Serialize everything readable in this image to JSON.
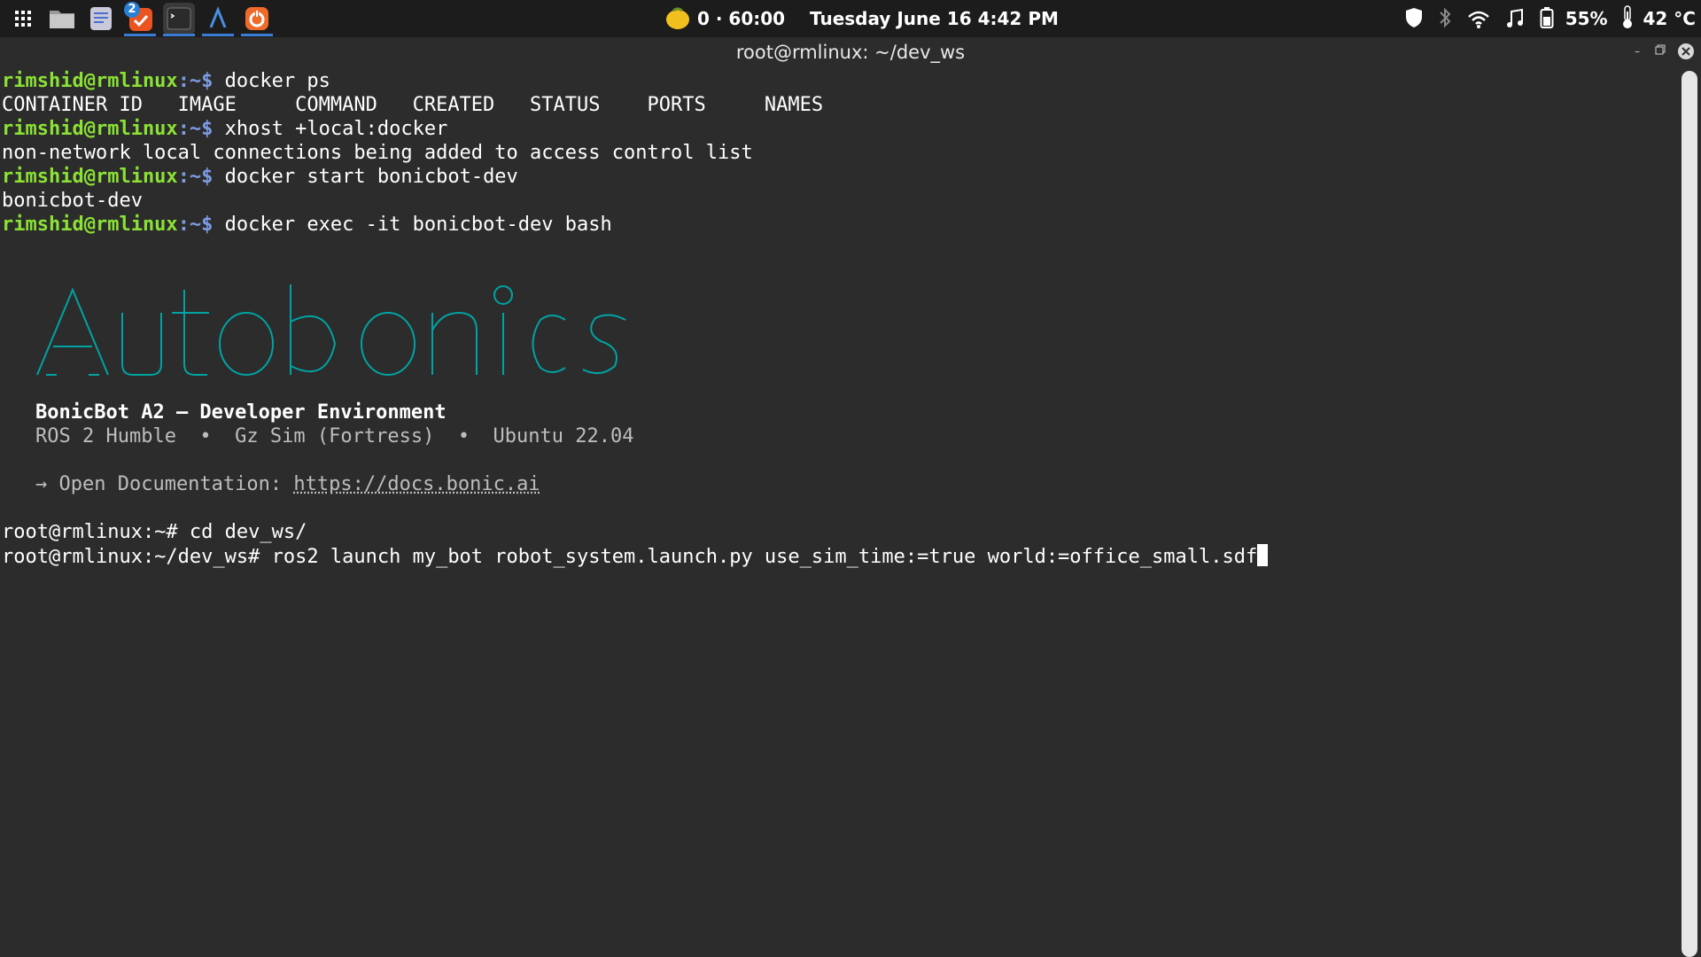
{
  "topbar": {
    "apps": [
      {
        "icon": "app-grid-icon"
      },
      {
        "icon": "files-icon"
      },
      {
        "icon": "text-editor-icon"
      },
      {
        "icon": "software-updater-icon",
        "badge": "2"
      },
      {
        "icon": "terminal-icon"
      },
      {
        "icon": "arduino-ide-icon"
      },
      {
        "icon": "ubuntu-software-icon"
      }
    ],
    "timer": "0 · 60:00",
    "datetime": "Tuesday  June 16  4:42 PM",
    "battery": "55%",
    "temperature": "42 °C",
    "tray_icons": [
      "shield-icon",
      "bluetooth-icon",
      "wifi-icon",
      "music-icon",
      "battery-icon",
      "thermometer-icon"
    ]
  },
  "window": {
    "title": "root@rmlinux: ~/dev_ws"
  },
  "terminal": {
    "lines": [
      {
        "prompt_user": "rimshid@rmlinux",
        "prompt_path": ":~$ ",
        "command": "docker ps"
      },
      {
        "output": "CONTAINER ID   IMAGE     COMMAND   CREATED   STATUS    PORTS     NAMES"
      },
      {
        "prompt_user": "rimshid@rmlinux",
        "prompt_path": ":~$ ",
        "command": "xhost +local:docker"
      },
      {
        "output": "non-network local connections being added to access control list"
      },
      {
        "prompt_user": "rimshid@rmlinux",
        "prompt_path": ":~$ ",
        "command": "docker start bonicbot-dev"
      },
      {
        "output": "bonicbot-dev"
      },
      {
        "prompt_user": "rimshid@rmlinux",
        "prompt_path": ":~$ ",
        "command": "docker exec -it bonicbot-dev bash"
      }
    ],
    "banner_title": "BonicBot A2 — Developer Environment",
    "banner_sub": "ROS 2 Humble  •  Gz Sim (Fortress)  •  Ubuntu 22.04",
    "doc_label": "→ Open Documentation: ",
    "doc_link": "https://docs.bonic.ai",
    "root_lines": [
      "root@rmlinux:~# cd dev_ws/",
      "root@rmlinux:~/dev_ws# ros2 launch my_bot robot_system.launch.py use_sim_time:=true world:=office_small.sdf"
    ]
  },
  "colors": {
    "accent": "#8ae234",
    "logo_cyan": "#00a3a3"
  }
}
